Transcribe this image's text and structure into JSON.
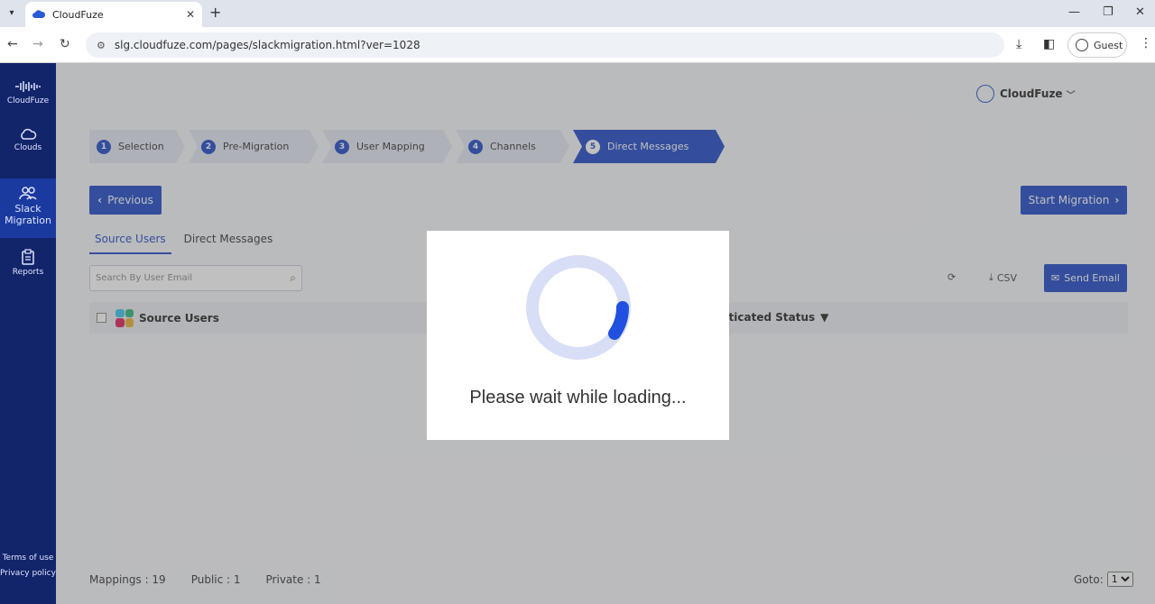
{
  "browser": {
    "tab_title": "CloudFuze",
    "url": "slg.cloudfuze.com/pages/slackmigration.html?ver=1028",
    "profile_label": "Guest"
  },
  "sidebar": {
    "brand": "CloudFuze",
    "items": [
      {
        "label": "Clouds",
        "icon": "cloud-icon"
      },
      {
        "label": "Slack Migration",
        "icon": "users-icon",
        "active": true
      },
      {
        "label": "Reports",
        "icon": "clipboard-icon"
      }
    ],
    "terms": "Terms of use",
    "privacy": "Privacy policy"
  },
  "header": {
    "user_name": "CloudFuze"
  },
  "steps": [
    {
      "num": "1",
      "label": "Selection"
    },
    {
      "num": "2",
      "label": "Pre-Migration"
    },
    {
      "num": "3",
      "label": "User Mapping"
    },
    {
      "num": "4",
      "label": "Channels"
    },
    {
      "num": "5",
      "label": "Direct Messages",
      "active": true
    }
  ],
  "actions": {
    "previous": "Previous",
    "start_migration": "Start Migration",
    "csv": "CSV",
    "send_email": "Send Email"
  },
  "tabs": {
    "source_users": "Source Users",
    "direct_messages": "Direct Messages"
  },
  "search": {
    "placeholder": "Search By User Email"
  },
  "table": {
    "col_source_users": "Source Users",
    "col_status": "nticated Status"
  },
  "footer": {
    "mappings": "Mappings : 19",
    "public": "Public : 1",
    "private": "Private : 1",
    "goto_label": "Goto:",
    "goto_value": "1"
  },
  "modal": {
    "message": "Please wait while loading..."
  },
  "colors": {
    "primary": "#1d47c7",
    "sidebar": "#12246a",
    "spinner_track": "#d9def7",
    "spinner_arc": "#2050e0"
  }
}
